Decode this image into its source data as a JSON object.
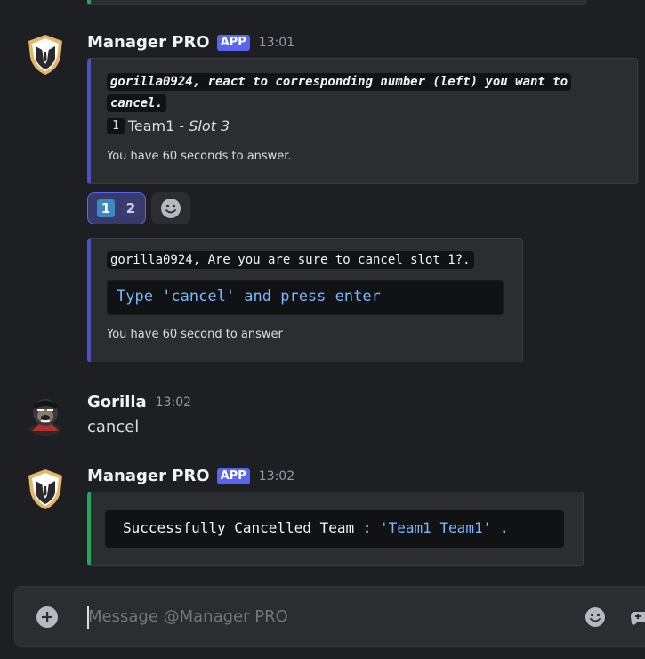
{
  "messages": [
    {
      "author": "Manager PRO",
      "tag": "APP",
      "time": "13:01",
      "embeds": [
        {
          "title_line1": "gorilla0924, react to corresponding number (left) you want to",
          "title_line2": "cancel.",
          "slot_number": "1",
          "team_name": "Team1",
          "separator": " - ",
          "slot": "Slot 3",
          "footer": "You have 60 seconds to answer."
        },
        {
          "prompt": "gorilla0924, Are you are sure to cancel slot 1?.",
          "code": "Type 'cancel' and press enter",
          "footer": "You have 60 second to answer"
        }
      ],
      "reactions": [
        "1",
        "2"
      ]
    },
    {
      "author": "Gorilla",
      "time": "13:02",
      "content": "cancel"
    },
    {
      "author": "Manager PRO",
      "tag": "APP",
      "time": "13:02",
      "result_prefix": "Successfully Cancelled Team : ",
      "result_value": "'Team1 Team1'",
      "result_suffix": " ."
    }
  ],
  "composer": {
    "placeholder": "Message @Manager PRO"
  },
  "colors": {
    "background": "#1e1f22",
    "embed": "#2b2d31",
    "blue_accent": "#4752c4",
    "green_accent": "#23a55a",
    "app_tag": "#5865f2",
    "code_blue": "#7ab7ff"
  }
}
